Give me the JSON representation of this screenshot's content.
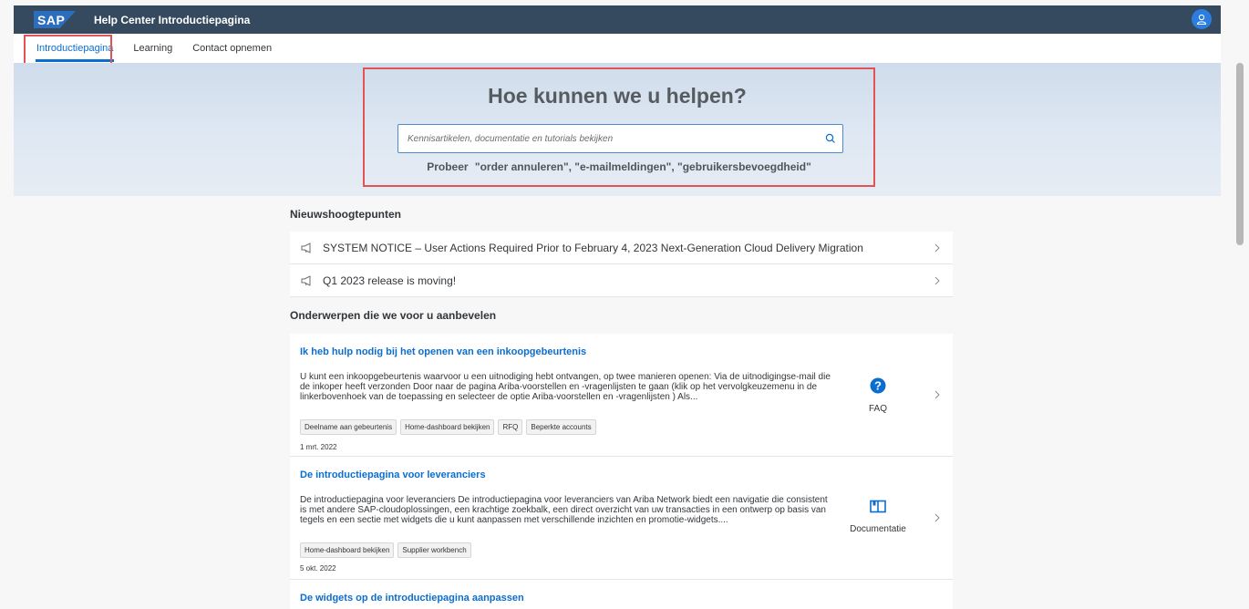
{
  "shell": {
    "logo_text": "SAP",
    "title": "Help Center Introductiepagina"
  },
  "tabs": [
    {
      "label": "Introductiepagina",
      "active": true
    },
    {
      "label": "Learning",
      "active": false
    },
    {
      "label": "Contact opnemen",
      "active": false
    }
  ],
  "hero": {
    "title": "Hoe kunnen we u helpen?",
    "search_placeholder": "Kennisartikelen, documentatie en tutorials bekijken",
    "hint_prefix": "Probeer",
    "hint_examples": "\"order annuleren\", \"e-mailmeldingen\", \"gebruikersbevoegdheid\""
  },
  "news": {
    "heading": "Nieuwshoogtepunten",
    "items": [
      "SYSTEM NOTICE – User Actions Required Prior to February 4, 2023 Next-Generation Cloud Delivery Migration",
      "Q1 2023 release is moving!"
    ]
  },
  "recommended": {
    "heading": "Onderwerpen die we voor u aanbevelen",
    "items": [
      {
        "title": "Ik heb hulp nodig bij het openen van een inkoopgebeurtenis",
        "description": "U kunt een inkoopgebeurtenis waarvoor u een uitnodiging hebt ontvangen, op twee manieren openen: Via de uitnodigingse-mail die de inkoper heeft verzonden Door naar de pagina Ariba-voorstellen en -vragenlijsten te gaan (klik op het vervolgkeuzemenu in de linkerbovenhoek van de toepassing en selecteer de optie Ariba-voorstellen en -vragenlijsten ) Als...",
        "tags": [
          "Deelname aan gebeurtenis",
          "Home-dashboard bekijken",
          "RFQ",
          "Beperkte accounts"
        ],
        "date": "1 mrt. 2022",
        "type": "FAQ"
      },
      {
        "title": "De introductiepagina voor leveranciers",
        "description": "De introductiepagina voor leveranciers De introductiepagina voor leveranciers van Ariba Network biedt een navigatie die consistent is met andere SAP-cloudoplossingen, een krachtige zoekbalk, een direct overzicht van uw transacties in een ontwerp op basis van tegels en een sectie met widgets die u kunt aanpassen met verschillende inzichten en promotie-widgets....",
        "tags": [
          "Home-dashboard bekijken",
          "Supplier workbench"
        ],
        "date": "5 okt. 2022",
        "type": "Documentatie"
      },
      {
        "title": "De widgets op de introductiepagina aanpassen"
      }
    ]
  },
  "colors": {
    "shell": "#354a5f",
    "accent": "#0a6ed1",
    "highlight": "#e25453"
  }
}
